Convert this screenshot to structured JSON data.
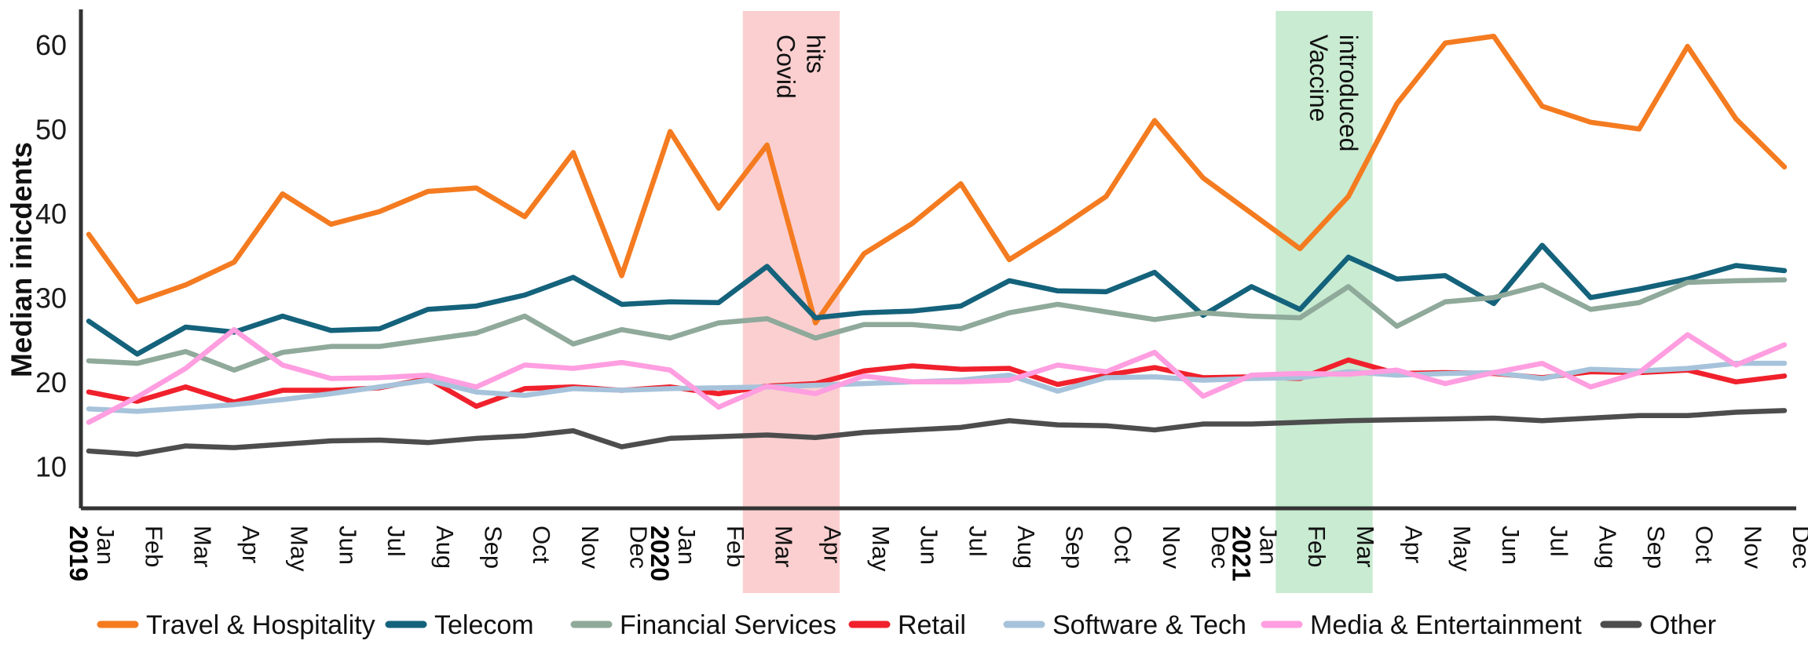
{
  "chart_data": {
    "type": "line",
    "title": "",
    "xlabel": "",
    "ylabel": "Median inicdents",
    "ylim": [
      5,
      64
    ],
    "yticks": [
      10,
      20,
      30,
      40,
      50,
      60
    ],
    "grid": false,
    "legend_position": "bottom",
    "x": [
      "Jan",
      "Feb",
      "Mar",
      "Apr",
      "May",
      "Jun",
      "Jul",
      "Aug",
      "Sep",
      "Oct",
      "Nov",
      "Dec",
      "Jan",
      "Feb",
      "Mar",
      "Apr",
      "May",
      "Jun",
      "Jul",
      "Aug",
      "Sep",
      "Oct",
      "Nov",
      "Dec",
      "Jan",
      "Feb",
      "Mar",
      "Apr",
      "May",
      "Jun",
      "Jul",
      "Aug",
      "Sep",
      "Oct",
      "Nov",
      "Dec"
    ],
    "year_markers": [
      {
        "label": "2019",
        "index": 0
      },
      {
        "label": "2020",
        "index": 12
      },
      {
        "label": "2021",
        "index": 24
      }
    ],
    "series": [
      {
        "name": "Travel & Hospitality",
        "color": "#F47B20",
        "values": [
          37.5,
          29.5,
          31.5,
          34.2,
          42.3,
          38.7,
          40.2,
          42.6,
          43.0,
          39.6,
          47.2,
          32.6,
          49.7,
          40.6,
          48.1,
          27.0,
          35.2,
          38.8,
          43.5,
          34.5,
          38.1,
          42.0,
          51.0,
          44.2,
          40.0,
          35.8,
          42.0,
          53.0,
          60.2,
          61.0,
          52.7,
          50.8,
          50.0,
          59.8,
          51.2,
          45.5
        ]
      },
      {
        "name": "Telecom",
        "color": "#14627B",
        "values": [
          27.2,
          23.3,
          26.5,
          25.9,
          27.8,
          26.1,
          26.3,
          28.6,
          29.0,
          30.3,
          32.4,
          29.2,
          29.5,
          29.4,
          33.7,
          27.6,
          28.2,
          28.4,
          29.0,
          32.0,
          30.8,
          30.7,
          33.0,
          27.9,
          31.3,
          28.6,
          34.8,
          32.2,
          32.6,
          29.3,
          36.2,
          30.0,
          31.0,
          32.2,
          33.8,
          33.2
        ]
      },
      {
        "name": "Financial Services",
        "color": "#8FA99A",
        "values": [
          22.5,
          22.2,
          23.6,
          21.4,
          23.5,
          24.2,
          24.2,
          25.0,
          25.8,
          27.8,
          24.5,
          26.2,
          25.2,
          27.0,
          27.5,
          25.2,
          26.8,
          26.8,
          26.3,
          28.2,
          29.2,
          28.3,
          27.4,
          28.2,
          27.8,
          27.6,
          31.3,
          26.6,
          29.5,
          30.0,
          31.5,
          28.6,
          29.4,
          31.8,
          32.0,
          32.1
        ]
      },
      {
        "name": "Retail",
        "color": "#F0212C",
        "values": [
          18.8,
          17.7,
          19.4,
          17.6,
          19.0,
          19.0,
          19.3,
          20.4,
          17.1,
          19.2,
          19.4,
          19.0,
          19.4,
          18.6,
          19.5,
          19.8,
          21.3,
          21.9,
          21.5,
          21.6,
          19.7,
          20.8,
          21.7,
          20.5,
          20.6,
          20.4,
          22.6,
          21.0,
          21.1,
          21.0,
          20.5,
          21.2,
          21.1,
          21.4,
          20.0,
          20.7
        ]
      },
      {
        "name": "Software & Tech",
        "color": "#A7C3DB",
        "values": [
          16.8,
          16.5,
          16.9,
          17.3,
          17.9,
          18.6,
          19.4,
          20.2,
          18.8,
          18.4,
          19.2,
          19.0,
          19.2,
          19.3,
          19.4,
          19.6,
          19.8,
          20.0,
          20.2,
          20.8,
          18.9,
          20.5,
          20.6,
          20.2,
          20.4,
          20.5,
          21.2,
          20.8,
          21.0,
          21.1,
          20.4,
          21.5,
          21.3,
          21.6,
          22.2,
          22.2
        ]
      },
      {
        "name": "Media & Entertainment",
        "color": "#FF9EE0",
        "values": [
          15.2,
          18.2,
          21.6,
          26.2,
          22.0,
          20.4,
          20.5,
          20.8,
          19.4,
          22.0,
          21.6,
          22.3,
          21.4,
          17.0,
          19.5,
          18.6,
          20.7,
          20.0,
          20.0,
          20.2,
          22.0,
          21.2,
          23.5,
          18.3,
          20.8,
          21.0,
          20.9,
          21.4,
          19.8,
          21.1,
          22.2,
          19.4,
          21.1,
          25.6,
          22.0,
          24.4
        ]
      },
      {
        "name": "Other",
        "color": "#4D4D4D",
        "values": [
          11.8,
          11.4,
          12.4,
          12.2,
          12.6,
          13.0,
          13.1,
          12.8,
          13.3,
          13.6,
          14.2,
          12.3,
          13.3,
          13.5,
          13.7,
          13.4,
          14.0,
          14.3,
          14.6,
          15.4,
          14.9,
          14.8,
          14.3,
          15.0,
          15.0,
          15.2,
          15.4,
          15.5,
          15.6,
          15.7,
          15.4,
          15.7,
          16.0,
          16.0,
          16.4,
          16.6
        ]
      }
    ],
    "annotations": [
      {
        "label": "Covid hits",
        "lines": [
          "Covid",
          "hits"
        ],
        "start_index": 14,
        "end_index": 15,
        "color": "#FBCFD0"
      },
      {
        "label": "Vaccine introduced",
        "lines": [
          "Vaccine",
          "introduced"
        ],
        "start_index": 25,
        "end_index": 26,
        "color": "#C8EBD1"
      }
    ]
  },
  "legend": {
    "items": [
      {
        "label": "Travel & Hospitality",
        "color": "#F47B20"
      },
      {
        "label": "Telecom",
        "color": "#14627B"
      },
      {
        "label": "Financial Services",
        "color": "#8FA99A"
      },
      {
        "label": "Retail",
        "color": "#F0212C"
      },
      {
        "label": "Software & Tech",
        "color": "#A7C3DB"
      },
      {
        "label": "Media & Entertainment",
        "color": "#FF9EE0"
      },
      {
        "label": "Other",
        "color": "#4D4D4D"
      }
    ]
  },
  "axis": {
    "y_label": "Median inicdents",
    "y_ticks": [
      "10",
      "20",
      "30",
      "40",
      "50",
      "60"
    ],
    "axis_color": "#333333"
  }
}
